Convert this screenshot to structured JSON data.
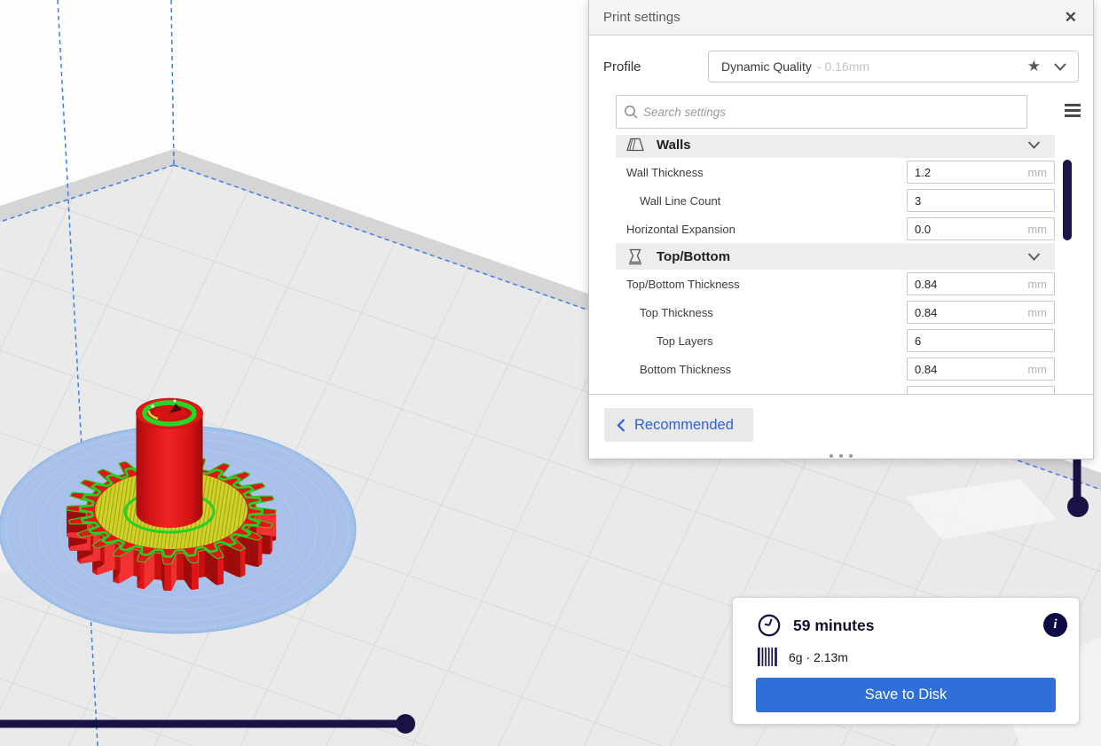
{
  "panel": {
    "title": "Print settings",
    "profile": {
      "label": "Profile",
      "value": "Dynamic Quality",
      "suffix": "- 0.16mm"
    },
    "search": {
      "placeholder": "Search settings"
    },
    "sections": [
      {
        "label": "Walls",
        "icon": "walls-icon",
        "rows": [
          {
            "label": "Wall Thickness",
            "value": "1.2",
            "unit": "mm",
            "indent": 0
          },
          {
            "label": "Wall Line Count",
            "value": "3",
            "unit": "",
            "indent": 1
          },
          {
            "label": "Horizontal Expansion",
            "value": "0.0",
            "unit": "mm",
            "indent": 0
          }
        ]
      },
      {
        "label": "Top/Bottom",
        "icon": "topbottom-icon",
        "rows": [
          {
            "label": "Top/Bottom Thickness",
            "value": "0.84",
            "unit": "mm",
            "indent": 0
          },
          {
            "label": "Top Thickness",
            "value": "0.84",
            "unit": "mm",
            "indent": 1
          },
          {
            "label": "Top Layers",
            "value": "6",
            "unit": "",
            "indent": 2
          },
          {
            "label": "Bottom Thickness",
            "value": "0.84",
            "unit": "mm",
            "indent": 1
          }
        ]
      }
    ],
    "footer": {
      "back_label": "Recommended"
    }
  },
  "action_card": {
    "time": "59 minutes",
    "material_usage": "6g · 2.13m",
    "save_label": "Save to Disk"
  },
  "icons": {
    "close": "✕",
    "star": "★"
  },
  "colors": {
    "accent_blue": "#2e6fd9",
    "navy": "#191244",
    "volume_edge_blue": "#3d7de6",
    "shell_red": "#e21616",
    "infill_yellow": "#d0d22c",
    "inner_wall_green": "#25cf25",
    "brim_blue": "#a8c0ea"
  }
}
